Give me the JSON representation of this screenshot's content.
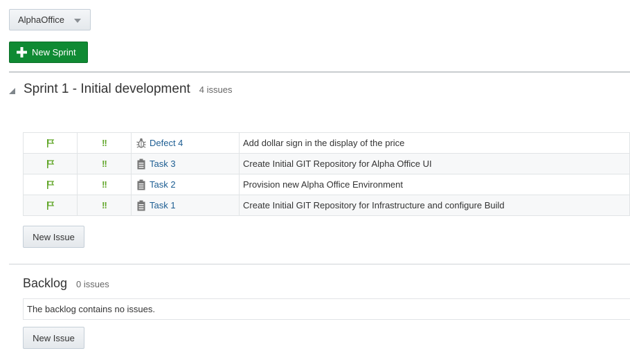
{
  "project_selector": {
    "value": "AlphaOffice"
  },
  "toolbar": {
    "new_sprint_label": "New Sprint"
  },
  "colors": {
    "primary_green": "#0f8a33",
    "link_blue": "#1c5d92",
    "flag_green": "#61a629"
  },
  "sprint": {
    "title": "Sprint 1 - Initial development",
    "count": "4 issues",
    "issues": [
      {
        "flag_icon": "flag-icon",
        "priority": "!!",
        "type_icon": "bug-icon",
        "id": "Defect 4",
        "summary": "Add dollar sign in the display of the price"
      },
      {
        "flag_icon": "flag-icon",
        "priority": "!!",
        "type_icon": "task-icon",
        "id": "Task 3",
        "summary": "Create Initial GIT Repository for Alpha Office UI"
      },
      {
        "flag_icon": "flag-icon",
        "priority": "!!",
        "type_icon": "task-icon",
        "id": "Task 2",
        "summary": "Provision new Alpha Office Environment"
      },
      {
        "flag_icon": "flag-icon",
        "priority": "!!",
        "type_icon": "task-icon",
        "id": "Task 1",
        "summary": "Create Initial GIT Repository for Infrastructure and configure Build"
      }
    ],
    "new_issue_label": "New Issue"
  },
  "backlog": {
    "title": "Backlog",
    "count": "0 issues",
    "empty_message": "The backlog contains no issues.",
    "new_issue_label": "New Issue"
  }
}
